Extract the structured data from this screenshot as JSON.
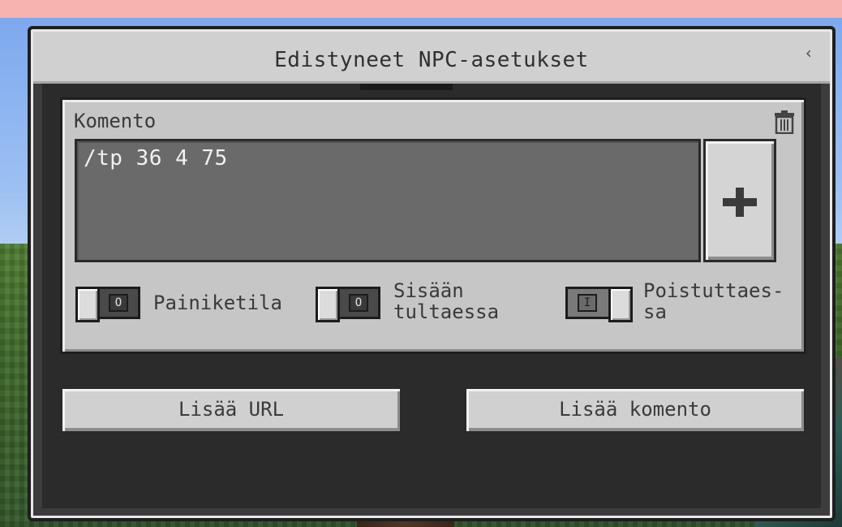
{
  "dialog": {
    "title": "Edistyneet NPC-asetukset",
    "back_icon": "chevron-left-icon",
    "back_glyph": "‹"
  },
  "command_card": {
    "label": "Komento",
    "delete_icon": "trash-icon",
    "command_text": "/tp 36 4 75",
    "add_icon": "plus-icon"
  },
  "toggles": [
    {
      "label_lines": [
        "Painiketila"
      ],
      "state": "off",
      "state_glyph": "O"
    },
    {
      "label_lines": [
        "Sisään",
        "tultaessa"
      ],
      "state": "off",
      "state_glyph": "O"
    },
    {
      "label_lines": [
        "Poistuttaes-",
        "sa"
      ],
      "state": "on",
      "state_glyph": "I"
    }
  ],
  "buttons": {
    "add_url": "Lisää URL",
    "add_command": "Lisää komento"
  },
  "colors": {
    "panel": "#c6c6c6",
    "command_box": "#6a6a6a",
    "button": "#d0d0d0",
    "text_dark": "#3a3a3a"
  }
}
